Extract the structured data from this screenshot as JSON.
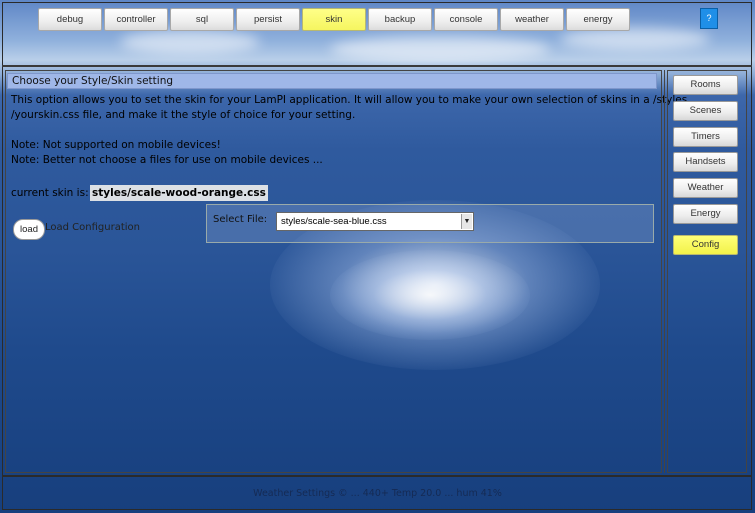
{
  "nav": {
    "items": [
      {
        "label": "debug"
      },
      {
        "label": "controller"
      },
      {
        "label": "sql"
      },
      {
        "label": "persist"
      },
      {
        "label": "skin"
      },
      {
        "label": "backup"
      },
      {
        "label": "console"
      },
      {
        "label": "weather"
      },
      {
        "label": "energy"
      }
    ],
    "active": "skin",
    "help_label": "?"
  },
  "panel": {
    "title": "Choose your Style/Skin setting",
    "description_line1": "This option allows you to set the skin for your LamPI application. It will allow you to make your own selection of skins in a /styles",
    "description_line2": "/yourskin.css file, and make it the style of choice for your setting.",
    "note1": "Note: Not supported on mobile devices!",
    "note2": "Note: Better not choose a files for use on mobile devices ...",
    "current_skin_label": "current skin is:",
    "current_skin_value": "styles/scale-wood-orange.css",
    "load_button": "load",
    "load_label": "Load Configuration",
    "select_file_label": "Select File:",
    "select_file_value": "styles/scale-sea-blue.css"
  },
  "sidebar": {
    "items": [
      {
        "label": "Rooms"
      },
      {
        "label": "Scenes"
      },
      {
        "label": "Timers"
      },
      {
        "label": "Handsets"
      },
      {
        "label": "Weather"
      },
      {
        "label": "Energy"
      },
      {
        "label": "Config"
      }
    ],
    "active": "Config"
  },
  "footer": {
    "text": "Weather Settings © ... 440+ Temp 20.0 ... hum 41%"
  },
  "colors": {
    "active_button": "#f5f560",
    "title_bar": "#9fb7e8",
    "help_button": "#1f8fe8"
  }
}
